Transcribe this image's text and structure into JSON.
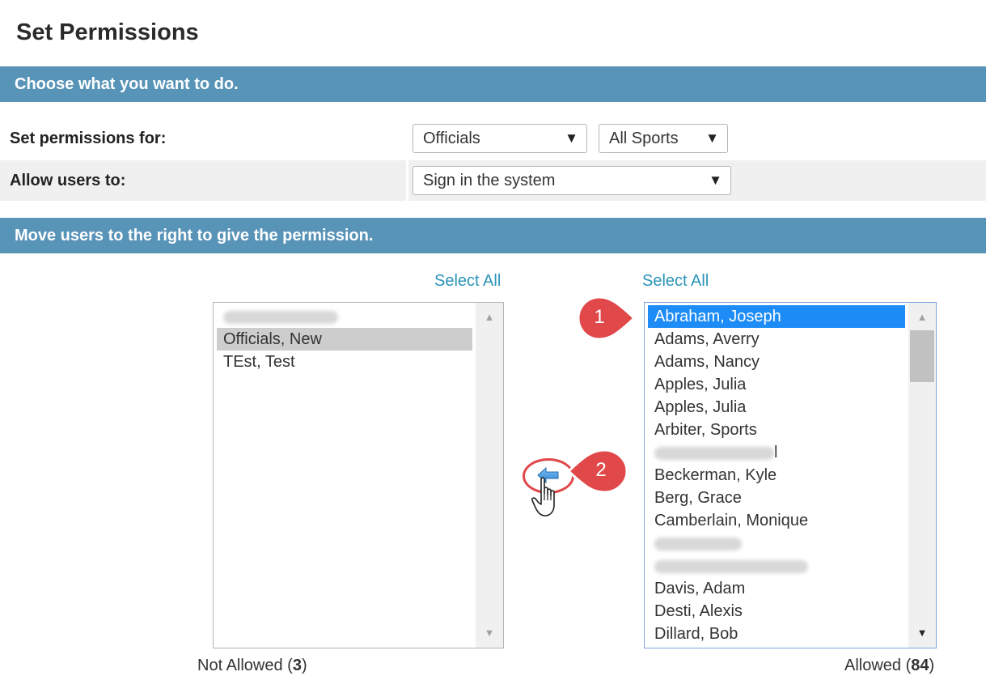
{
  "page": {
    "title": "Set Permissions"
  },
  "sections": {
    "choose": "Choose what you want to do.",
    "move": "Move users to the right to give the permission."
  },
  "form": {
    "set_permissions_label": "Set permissions for:",
    "role_select": {
      "value": "Officials"
    },
    "sport_select": {
      "value": "All Sports"
    },
    "allow_label": "Allow users to:",
    "action_select": {
      "value": "Sign in the system"
    }
  },
  "lists": {
    "select_all_label": "Select All",
    "not_allowed": {
      "label": "Not Allowed",
      "count": "3",
      "items": [
        {
          "name": "",
          "blurred": true
        },
        {
          "name": "Officials, New",
          "selected": true
        },
        {
          "name": "TEst, Test"
        }
      ]
    },
    "allowed": {
      "label": "Allowed",
      "count": "84",
      "items": [
        {
          "name": "Abraham, Joseph",
          "selected": true
        },
        {
          "name": "Adams, Averry"
        },
        {
          "name": "Adams, Nancy"
        },
        {
          "name": "Apples, Julia"
        },
        {
          "name": "Apples, Julia"
        },
        {
          "name": "Arbiter, Sports"
        },
        {
          "name": "l",
          "blurred": true
        },
        {
          "name": "Beckerman, Kyle"
        },
        {
          "name": "Berg, Grace"
        },
        {
          "name": "Camberlain, Monique"
        },
        {
          "name": "",
          "blurred": true
        },
        {
          "name": "",
          "blurred": true
        },
        {
          "name": "Davis, Adam"
        },
        {
          "name": "Desti, Alexis"
        },
        {
          "name": "Dillard, Bob"
        }
      ]
    }
  },
  "callouts": {
    "first": "1",
    "second": "2"
  },
  "icons": {
    "dropdown": "triangle-down",
    "move_left": "left-arrow-icon",
    "cursor": "hand-pointer-icon"
  },
  "colors": {
    "section_bar": "#5893b8",
    "link": "#2a94b8",
    "selected_blue": "#1e8cf6",
    "callout_red": "#e0484a"
  }
}
